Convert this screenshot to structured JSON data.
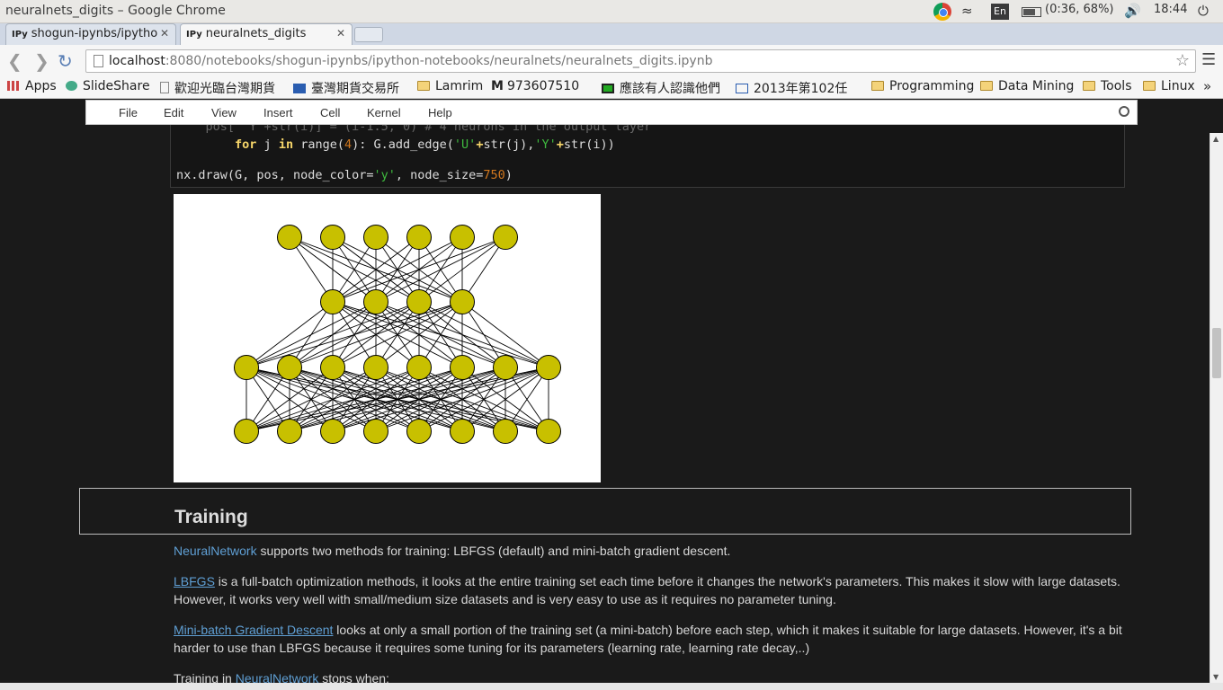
{
  "window": {
    "title": "neuralnets_digits – Google Chrome"
  },
  "tray": {
    "wifi_icon": "wifi-icon",
    "lang": "En",
    "battery": "(0:36, 68%)",
    "volume_icon": "volume-icon",
    "clock": "18:44",
    "power_icon": "power-icon"
  },
  "tabs": [
    {
      "fav": "IPy",
      "label": "shogun-ipynbs/ipytho",
      "active": false
    },
    {
      "fav": "IPy",
      "label": "neuralnets_digits",
      "active": true
    }
  ],
  "omnibox": {
    "host": "localhost",
    "path": ":8080/notebooks/shogun-ipynbs/ipython-notebooks/neuralnets/neuralnets_digits.ipynb"
  },
  "bookmarks": [
    {
      "label": "Apps",
      "icon": "apps-icon"
    },
    {
      "label": "SlideShare",
      "icon": "slideshare-icon"
    },
    {
      "label": "歡迎光臨台灣期貨",
      "icon": "page-icon"
    },
    {
      "label": "臺灣期貨交易所",
      "icon": "taifex-icon"
    },
    {
      "label": "Lamrim",
      "icon": "folder-icon"
    },
    {
      "label": "973607510",
      "icon": "m-icon"
    },
    {
      "label": "應該有人認識他們",
      "icon": "page-icon"
    },
    {
      "label": "2013年第102任",
      "icon": "calendar-icon"
    },
    {
      "label": "Programming",
      "icon": "folder-icon"
    },
    {
      "label": "Data Mining",
      "icon": "folder-icon"
    },
    {
      "label": "Tools",
      "icon": "folder-icon"
    },
    {
      "label": "Linux",
      "icon": "folder-icon"
    }
  ],
  "notebook_menu": [
    "File",
    "Edit",
    "View",
    "Insert",
    "Cell",
    "Kernel",
    "Help"
  ],
  "code": {
    "hidden_line": "    pos[ 'Y'+str(i)] = (i-1.5, 0) # 4 neurons in the output layer",
    "line1_indent": "        ",
    "line1_for": "for",
    "line1_a": " j ",
    "line1_in": "in",
    "line1_range": " range(",
    "line1_num": "4",
    "line1_b": "): G.add_edge(",
    "line1_s1": "'U'",
    "line1_c": "+",
    "line1_str1": "str",
    "line1_d": "(j),",
    "line1_s2": "'Y'",
    "line1_e": "+",
    "line1_str2": "str",
    "line1_f": "(i))",
    "line2_a": "nx.draw(G, pos, node_color=",
    "line2_s": "'y'",
    "line2_b": ", node_size=",
    "line2_n": "750",
    "line2_c": ")"
  },
  "network": {
    "layers": [
      6,
      4,
      8,
      8
    ],
    "node_color": "#c8c000"
  },
  "training": {
    "heading": "Training",
    "p1_link": "NeuralNetwork",
    "p1_text": " supports two methods for training: LBFGS (default) and mini-batch gradient descent.",
    "p2_link": "LBFGS",
    "p2_text": " is a full-batch optimization methods, it looks at the entire training set each time before it changes the network's parameters. This makes it slow with large datasets. However, it works very well with small/medium size datasets and is very easy to use as it requires no parameter tuning.",
    "p3_link": "Mini-batch Gradient Descent",
    "p3_text": " looks at only a small portion of the training set (a mini-batch) before each step, which it makes it suitable for large datasets. However, it's a bit harder to use than LBFGS because it requires some tuning for its parameters (learning rate, learning rate decay,..)",
    "p4_pre": "Training in ",
    "p4_link": "NeuralNetwork",
    "p4_post": " stops when:"
  }
}
